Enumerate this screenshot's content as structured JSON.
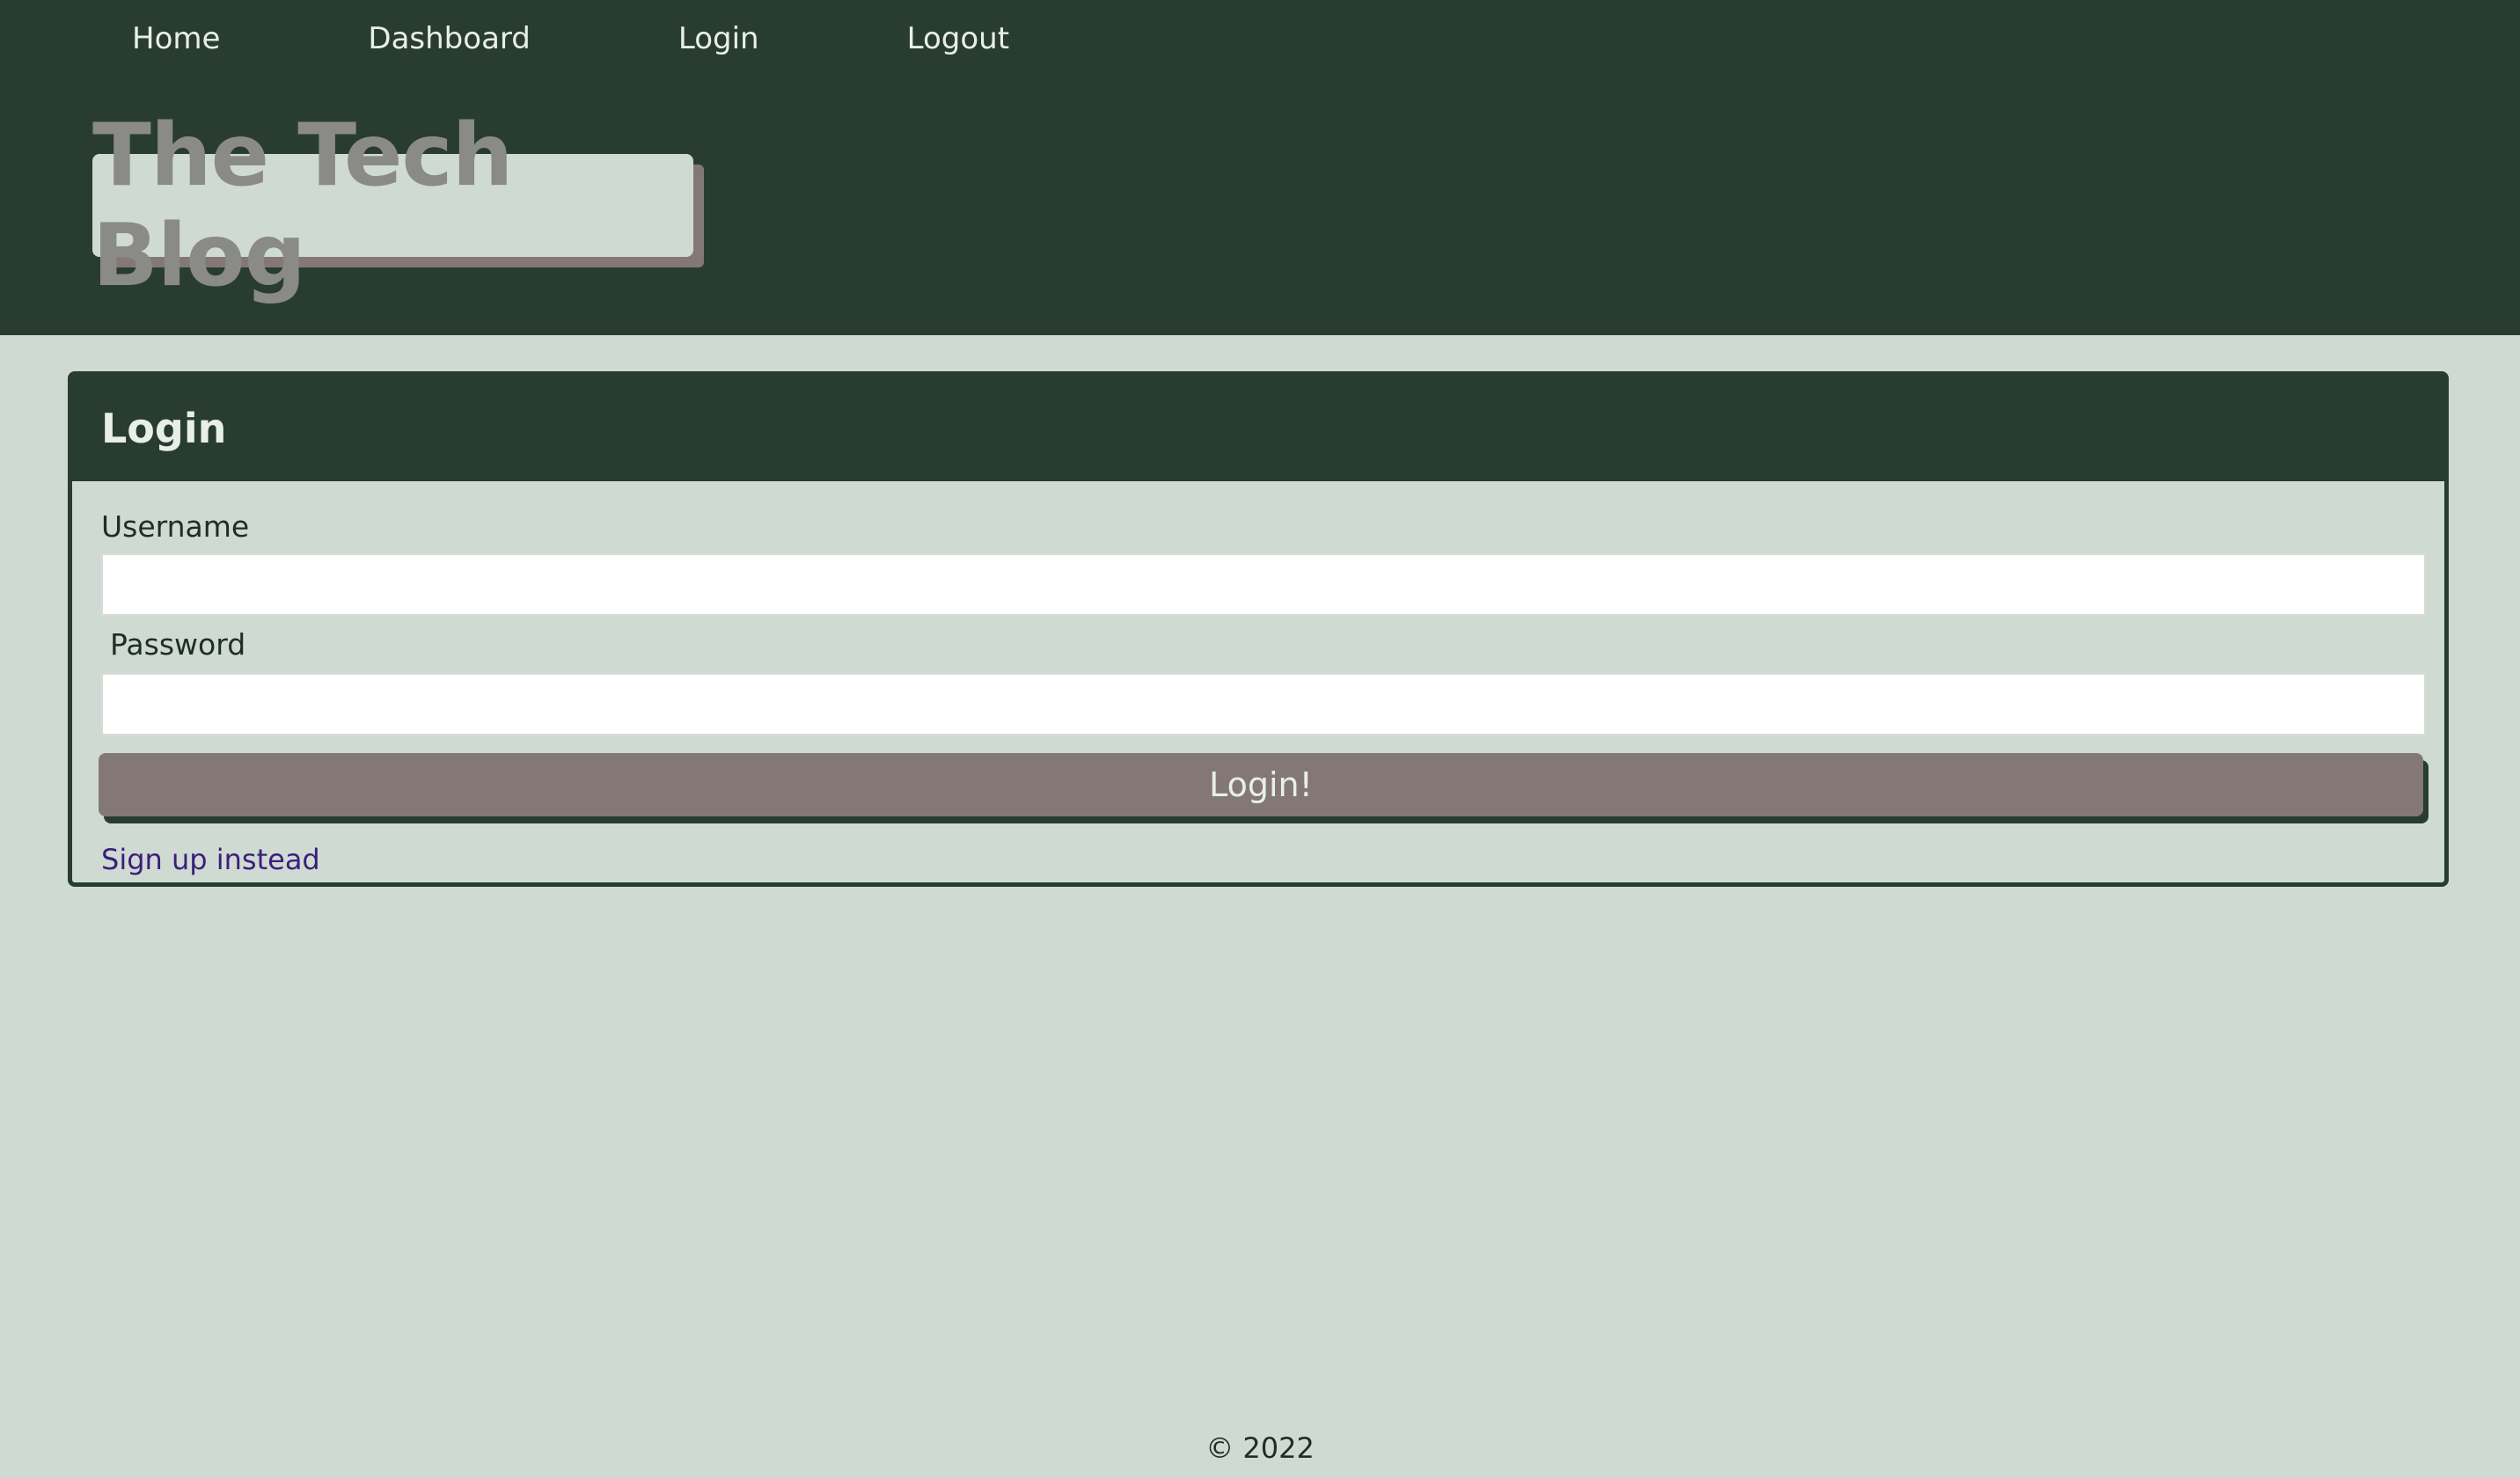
{
  "nav": {
    "items": [
      "Home",
      "Dashboard",
      "Login",
      "Logout"
    ]
  },
  "brand": {
    "title": "The Tech Blog"
  },
  "login": {
    "header": "Login",
    "username_label": "Username",
    "password_label": "Password",
    "button_label": "Login!",
    "signup_link": "Sign up instead"
  },
  "footer": {
    "text": "© 2022"
  },
  "colors": {
    "page_bg": "#cfdad3",
    "header_bg": "#283d30",
    "button_bg": "#847876",
    "link": "#3b1f7a"
  }
}
